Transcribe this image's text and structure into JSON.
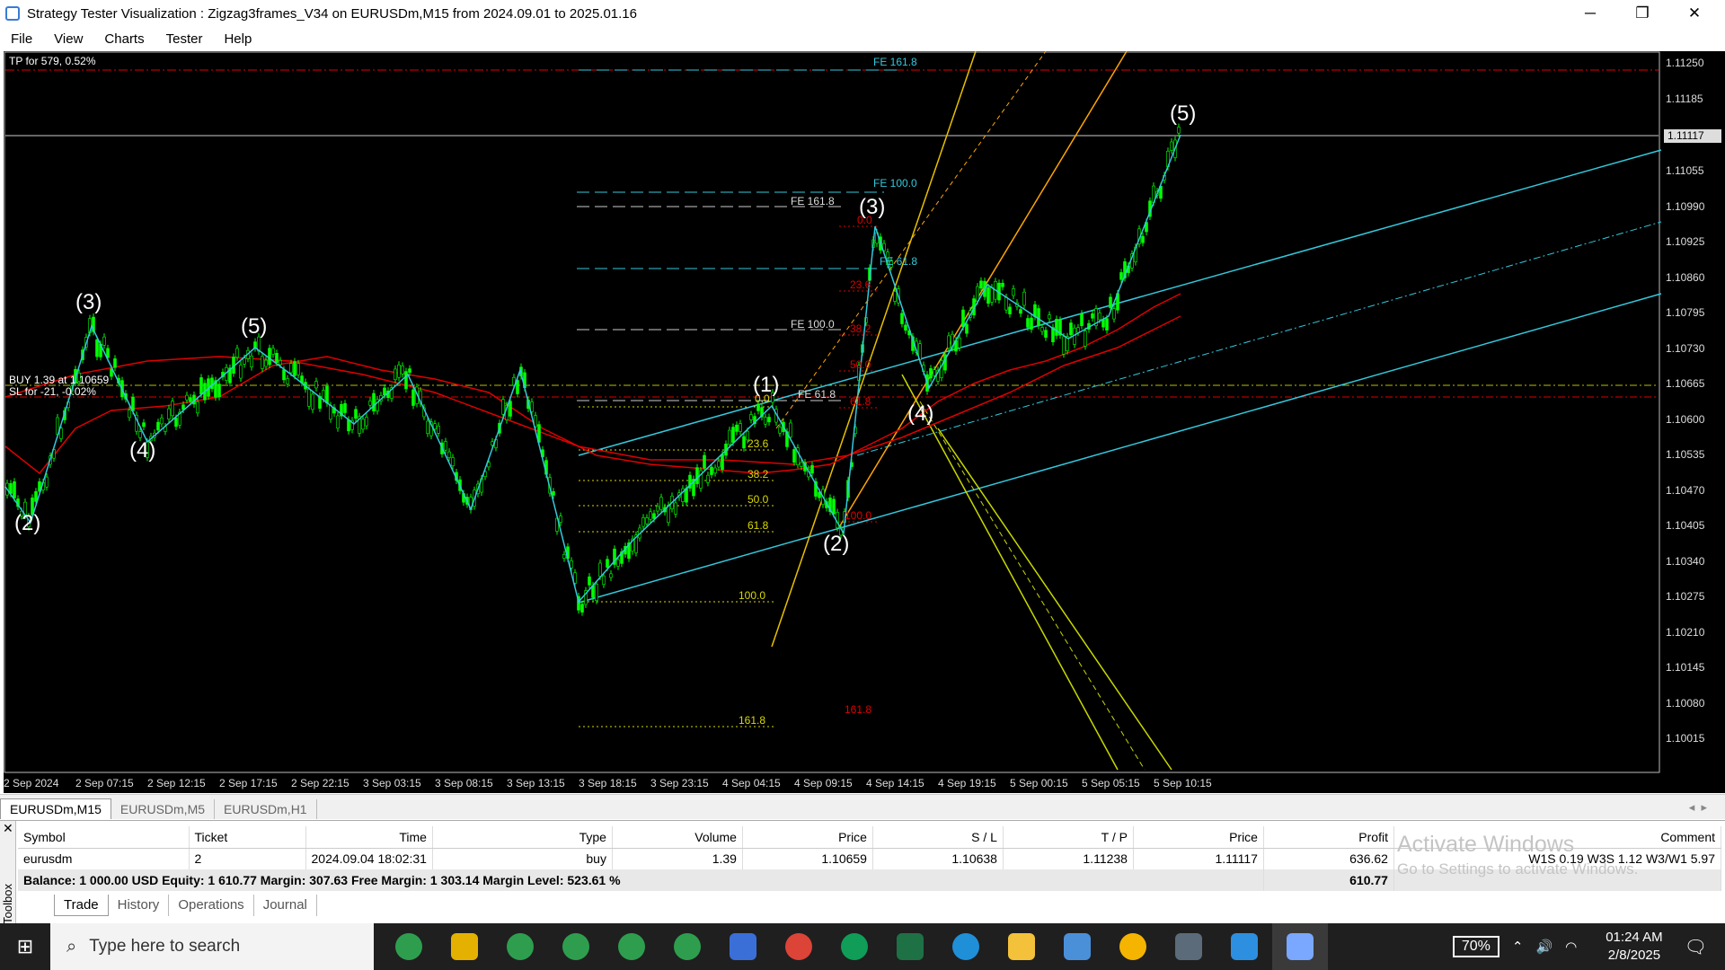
{
  "window": {
    "title": "Strategy Tester Visualization : Zigzag3frames_V34 on EURUSDm,M15 from 2024.09.01 to 2025.01.16",
    "minimize": "─",
    "restore": "❐",
    "close": "✕"
  },
  "menu": [
    "File",
    "View",
    "Charts",
    "Tester",
    "Help"
  ],
  "chart": {
    "tp_label": "TP for 579, 0.52%",
    "buy_label": "BUY 1.39 at 1.10659",
    "sl_label": "SL for -21, -0.02%",
    "price_axis": [
      "1.11250",
      "1.11185",
      "1.11117",
      "1.11055",
      "1.10990",
      "1.10925",
      "1.10860",
      "1.10795",
      "1.10730",
      "1.10665",
      "1.10600",
      "1.10535",
      "1.10470",
      "1.10405",
      "1.10340",
      "1.10275",
      "1.10210",
      "1.10145",
      "1.10080",
      "1.10015"
    ],
    "current_price": "1.11117",
    "time_axis": [
      "2 Sep 2024",
      "2 Sep 07:15",
      "2 Sep 12:15",
      "2 Sep 17:15",
      "2 Sep 22:15",
      "3 Sep 03:15",
      "3 Sep 08:15",
      "3 Sep 13:15",
      "3 Sep 18:15",
      "3 Sep 23:15",
      "4 Sep 04:15",
      "4 Sep 09:15",
      "4 Sep 14:15",
      "4 Sep 19:15",
      "5 Sep 00:15",
      "5 Sep 05:15",
      "5 Sep 10:15"
    ],
    "wave_labels": [
      "(2)",
      "(3)",
      "(4)",
      "(5)",
      "(1)",
      "(2)",
      "(3)",
      "(4)",
      "(5)"
    ],
    "fe_labels": [
      "FE 161.8",
      "FE 100.0",
      "FE 161.8",
      "FE 61.8",
      "FE 100.0",
      "FE 61.8"
    ],
    "fib_yellow": [
      "0.0",
      "23.6",
      "38.2",
      "50.0",
      "61.8",
      "100.0",
      "161.8"
    ],
    "fib_red": [
      "0.0",
      "23.6",
      "38.2",
      "50.0",
      "61.8",
      "100.0",
      "161.8"
    ],
    "colors": {
      "bull": "#00ff00",
      "cyan": "#33c8dc",
      "red": "#e00000",
      "orange": "#ffa500",
      "yellow": "#d9d900",
      "wave": "#ffffff"
    }
  },
  "chart_tabs": [
    "EURUSDm,M15",
    "EURUSDm,M5",
    "EURUSDm,H1"
  ],
  "trade_table": {
    "headers": [
      "Symbol",
      "Ticket",
      "Time",
      "Type",
      "Volume",
      "Price",
      "S / L",
      "T / P",
      "Price",
      "Profit",
      "Comment"
    ],
    "row": [
      "eurusdm",
      "2",
      "2024.09.04 18:02:31",
      "buy",
      "1.39",
      "1.10659",
      "1.10638",
      "1.11238",
      "1.11117",
      "636.62",
      "W1S 0.19 W3S 1.12 W3/W1 5.97"
    ],
    "balance_line": "Balance: 1 000.00 USD  Equity: 1 610.77  Margin: 307.63  Free Margin: 1 303.14  Margin Level: 523.61 %",
    "balance_profit": "610.77"
  },
  "toolbox_label": "Toolbox",
  "bottom_tabs": [
    "Trade",
    "History",
    "Operations",
    "Journal"
  ],
  "watermark": {
    "line1": "Activate Windows",
    "line2": "Go to Settings to activate Windows."
  },
  "taskbar": {
    "search_placeholder": "Type here to search",
    "battery": "70%",
    "time": "01:24 AM",
    "date": "2/8/2025"
  }
}
